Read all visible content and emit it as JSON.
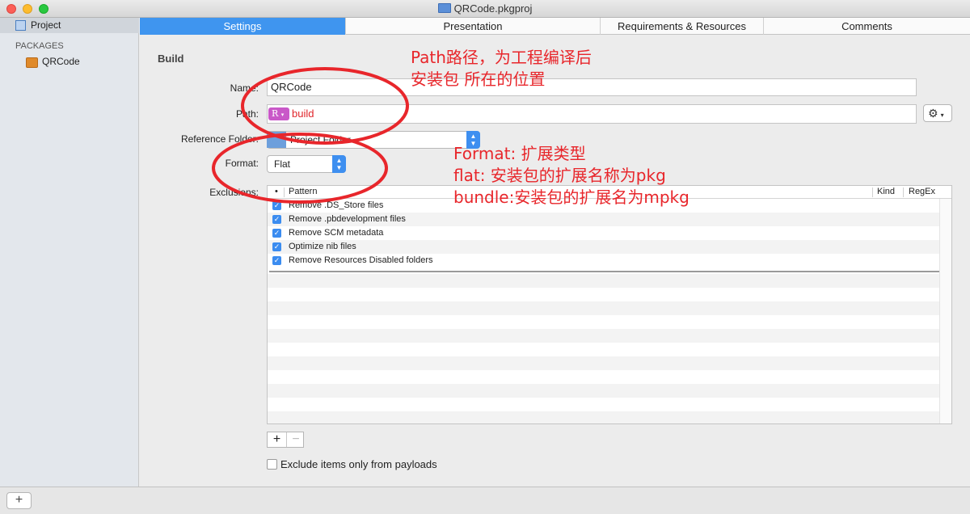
{
  "window": {
    "title": "QRCode.pkgproj"
  },
  "sidebar": {
    "project_label": "Project",
    "packages_heading": "PACKAGES",
    "package_item": "QRCode"
  },
  "bottom": {
    "add_label": "+"
  },
  "tabs": [
    {
      "label": "Settings",
      "active": true
    },
    {
      "label": "Presentation"
    },
    {
      "label": "Requirements & Resources"
    },
    {
      "label": "Comments"
    }
  ],
  "build": {
    "section_title": "Build",
    "name_label": "Name:",
    "name_value": "QRCode",
    "path_label": "Path:",
    "path_badge": "R",
    "path_value": "build",
    "reference_label": "Reference Folder:",
    "reference_value": "Project Folder",
    "format_label": "Format:",
    "format_value": "Flat",
    "exclusions_label": "Exclusions:"
  },
  "exclusions_table": {
    "headers": {
      "bullet": "•",
      "pattern": "Pattern",
      "kind": "Kind",
      "regex": "RegEx"
    },
    "rows": [
      {
        "checked": true,
        "pattern": "Remove .DS_Store files"
      },
      {
        "checked": true,
        "pattern": "Remove .pbdevelopment files"
      },
      {
        "checked": true,
        "pattern": "Remove SCM metadata"
      },
      {
        "checked": true,
        "pattern": "Optimize nib files"
      },
      {
        "checked": true,
        "pattern": "Remove Resources Disabled folders"
      }
    ],
    "add_label": "+",
    "remove_label": "−"
  },
  "exclude_payloads": {
    "checked": false,
    "label": "Exclude items only from payloads"
  },
  "annotations": {
    "path_note_line1": "Path路径，为工程编译后",
    "path_note_line2": "安装包 所在的位置",
    "format_note_line1": "Format: 扩展类型",
    "format_note_line2": "flat: 安装包的扩展名称为pkg",
    "format_note_line3": "bundle:安装包的扩展名为mpkg",
    "color": "#e8262b"
  },
  "colors": {
    "accent": "#3f95ef",
    "badge": "#c958c8"
  }
}
